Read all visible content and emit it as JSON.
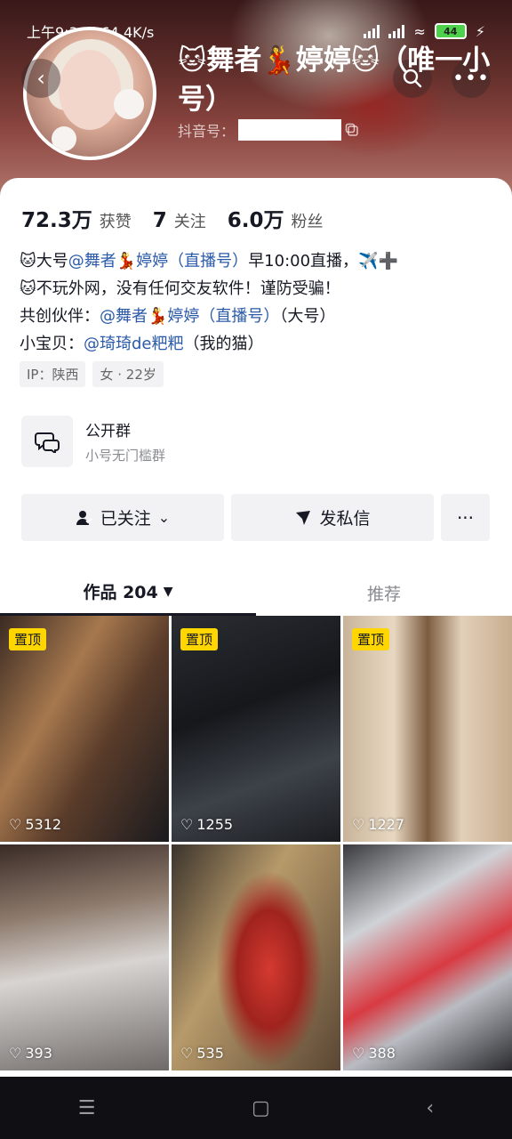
{
  "status_bar": {
    "time_speed": "上午9:30 | 64.4K/s",
    "battery": "44"
  },
  "profile": {
    "name": "🐱舞者💃婷婷🐱（唯一小号）",
    "id_label": "抖音号：",
    "stats": [
      {
        "num": "72.3万",
        "label": "获赞"
      },
      {
        "num": "7",
        "label": "关注"
      },
      {
        "num": "6.0万",
        "label": "粉丝"
      }
    ],
    "bio": {
      "line1_a": "🐱大号",
      "line1_link": "@舞者💃婷婷（直播号）",
      "line1_b": "早10:00直播，✈️➕",
      "line2": "🐱不玩外网，没有任何交友软件！谨防受骗！",
      "line3_a": "共创伙伴：",
      "line3_link": "@舞者💃婷婷（直播号）",
      "line3_b": "（大号）",
      "line4_a": "小宝贝：",
      "line4_link": "@琦琦de粑粑",
      "line4_b": "（我的猫）"
    },
    "tags": [
      "IP：陕西",
      "女 · 22岁"
    ]
  },
  "group": {
    "title": "公开群",
    "subtitle": "小号无门槛群"
  },
  "actions": {
    "follow": "已关注",
    "message": "发私信",
    "more": "···"
  },
  "tabs": {
    "works": "作品 204",
    "recommend": "推荐"
  },
  "grid": [
    {
      "pinned": "置顶",
      "likes": "5312"
    },
    {
      "pinned": "置顶",
      "likes": "1255"
    },
    {
      "pinned": "置顶",
      "likes": "1227"
    },
    {
      "pinned": "",
      "likes": "393"
    },
    {
      "pinned": "",
      "likes": "535"
    },
    {
      "pinned": "",
      "likes": "388"
    }
  ]
}
